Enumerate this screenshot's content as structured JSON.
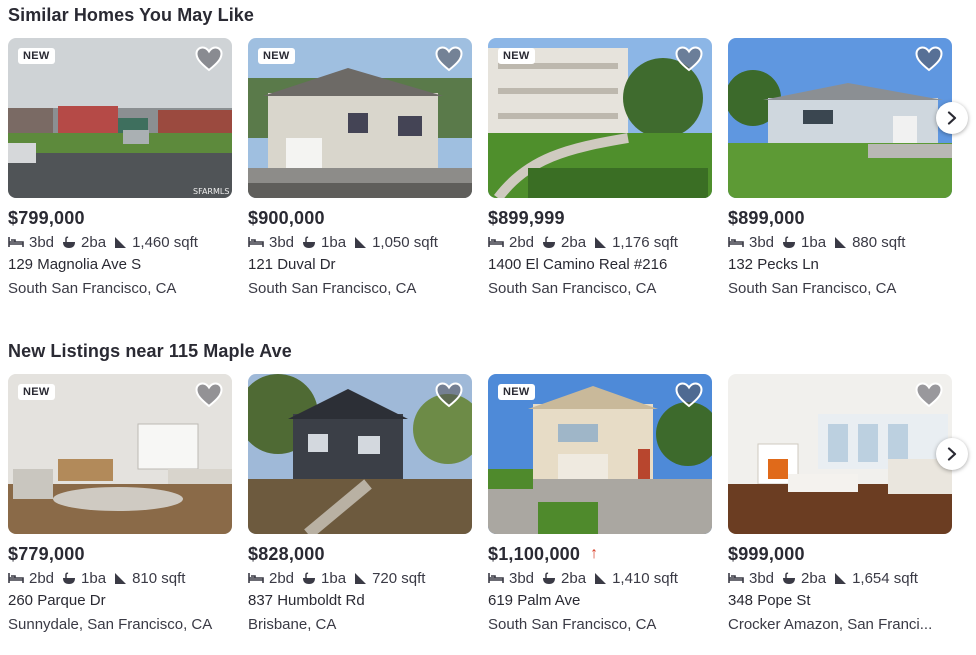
{
  "sections": [
    {
      "title": "Similar Homes You May Like",
      "cards": [
        {
          "badge": "NEW",
          "price": "$799,000",
          "beds": "3bd",
          "baths": "2ba",
          "sqft": "1,460 sqft",
          "address": "129 Magnolia Ave S",
          "city": "South San Francisco, CA",
          "photo_caption": "SFARMLS"
        },
        {
          "badge": "NEW",
          "price": "$900,000",
          "beds": "3bd",
          "baths": "1ba",
          "sqft": "1,050 sqft",
          "address": "121 Duval Dr",
          "city": "South San Francisco, CA"
        },
        {
          "badge": "NEW",
          "price": "$899,999",
          "beds": "2bd",
          "baths": "2ba",
          "sqft": "1,176 sqft",
          "address": "1400 El Camino Real #216",
          "city": "South San Francisco, CA"
        },
        {
          "badge": "",
          "price": "$899,000",
          "beds": "3bd",
          "baths": "1ba",
          "sqft": "880 sqft",
          "address": "132 Pecks Ln",
          "city": "South San Francisco, CA"
        }
      ]
    },
    {
      "title": "New Listings near 115 Maple Ave",
      "cards": [
        {
          "badge": "NEW",
          "price": "$779,000",
          "beds": "2bd",
          "baths": "1ba",
          "sqft": "810 sqft",
          "address": "260 Parque Dr",
          "city": "Sunnydale, San Francisco, CA"
        },
        {
          "badge": "",
          "price": "$828,000",
          "beds": "2bd",
          "baths": "1ba",
          "sqft": "720 sqft",
          "address": "837 Humboldt Rd",
          "city": "Brisbane, CA"
        },
        {
          "badge": "NEW",
          "price": "$1,100,000",
          "price_change": "↑",
          "beds": "3bd",
          "baths": "2ba",
          "sqft": "1,410 sqft",
          "address": "619 Palm Ave",
          "city": "South San Francisco, CA"
        },
        {
          "badge": "",
          "price": "$999,000",
          "beds": "3bd",
          "baths": "2ba",
          "sqft": "1,654 sqft",
          "address": "348 Pope St",
          "city": "Crocker Amazon, San Franci..."
        }
      ]
    }
  ],
  "icons": {
    "favorite": "heart-icon",
    "beds": "bed-icon",
    "baths": "bath-icon",
    "sqft": "area-icon",
    "next": "chevron-right-icon"
  },
  "colors": {
    "text": "#2a2a33",
    "badge_bg": "#ffffff",
    "price_up": "#d9412b"
  }
}
